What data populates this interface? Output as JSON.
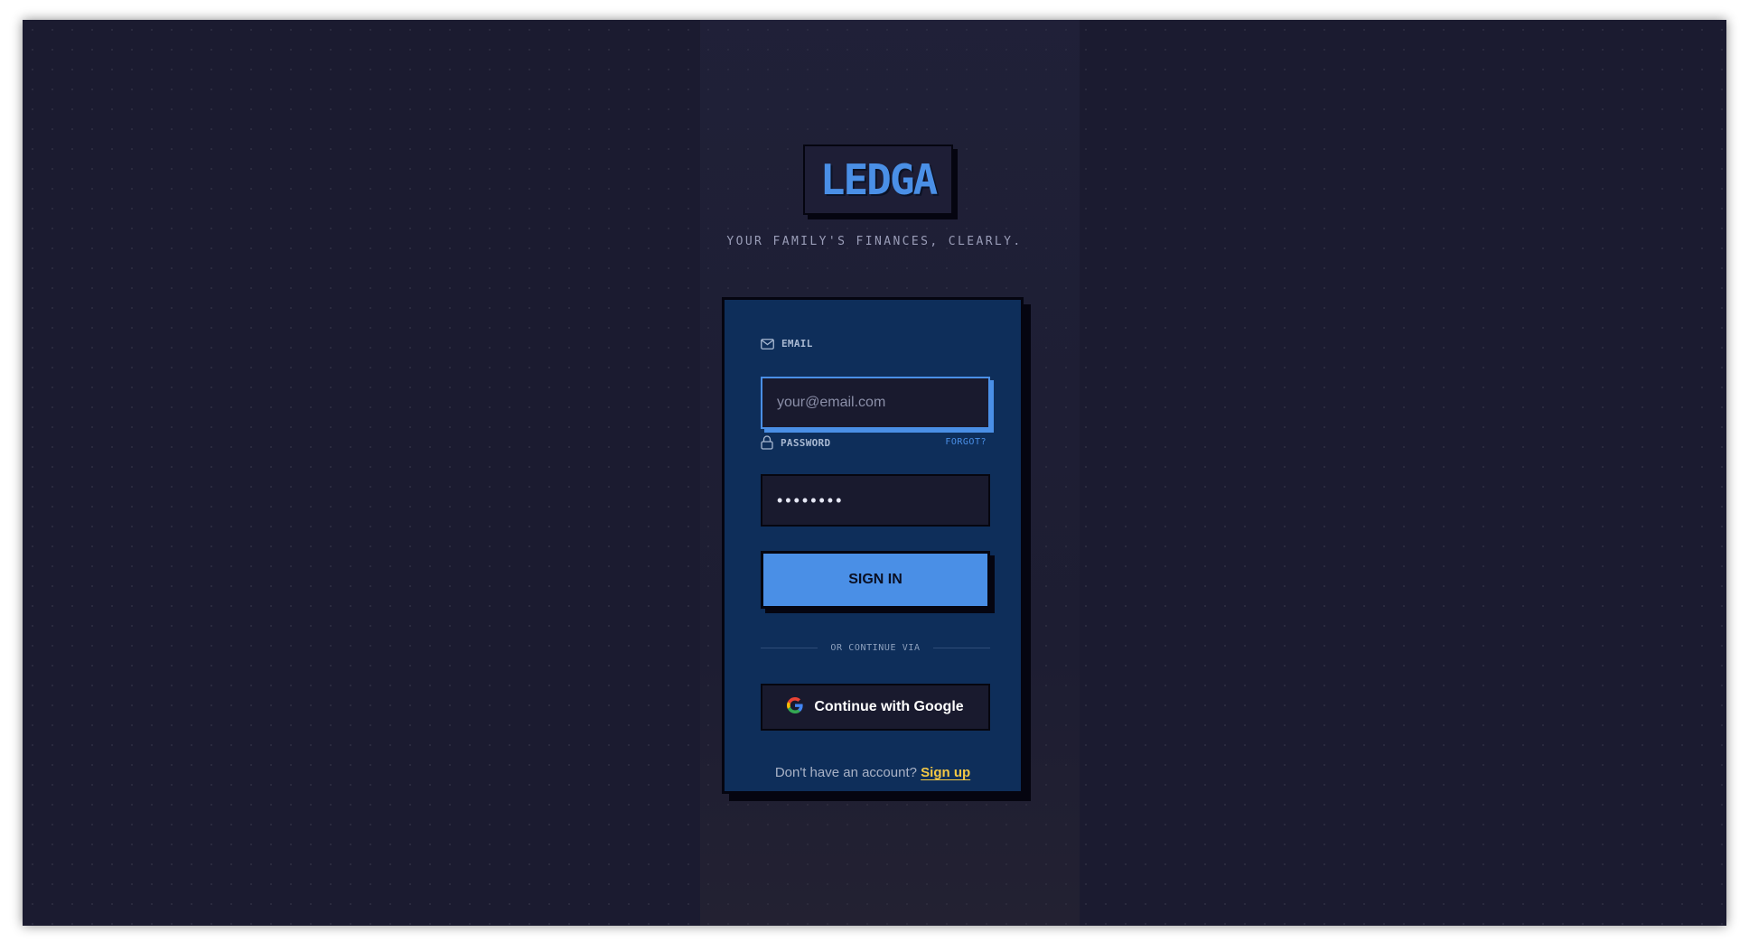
{
  "brand": {
    "logo_text": "LEDGA",
    "tagline": "YOUR FAMILY'S FINANCES, CLEARLY."
  },
  "form": {
    "email_label": "EMAIL",
    "email_placeholder": "your@email.com",
    "email_value": "",
    "password_label": "PASSWORD",
    "forgot_label": "FORGOT?",
    "password_value": "••••••••",
    "signin_label": "SIGN IN",
    "divider_text": "OR CONTINUE VIA",
    "google_label": "Continue with Google",
    "signup_prompt": "Don't have an account?",
    "signup_link": "Sign up"
  },
  "colors": {
    "accent": "#4a8fe6",
    "card": "#0e2e5a",
    "background": "#1b1b30",
    "link": "#f3c845"
  },
  "icons": {
    "email": "mail-icon",
    "password": "lock-icon",
    "google": "google-icon"
  }
}
